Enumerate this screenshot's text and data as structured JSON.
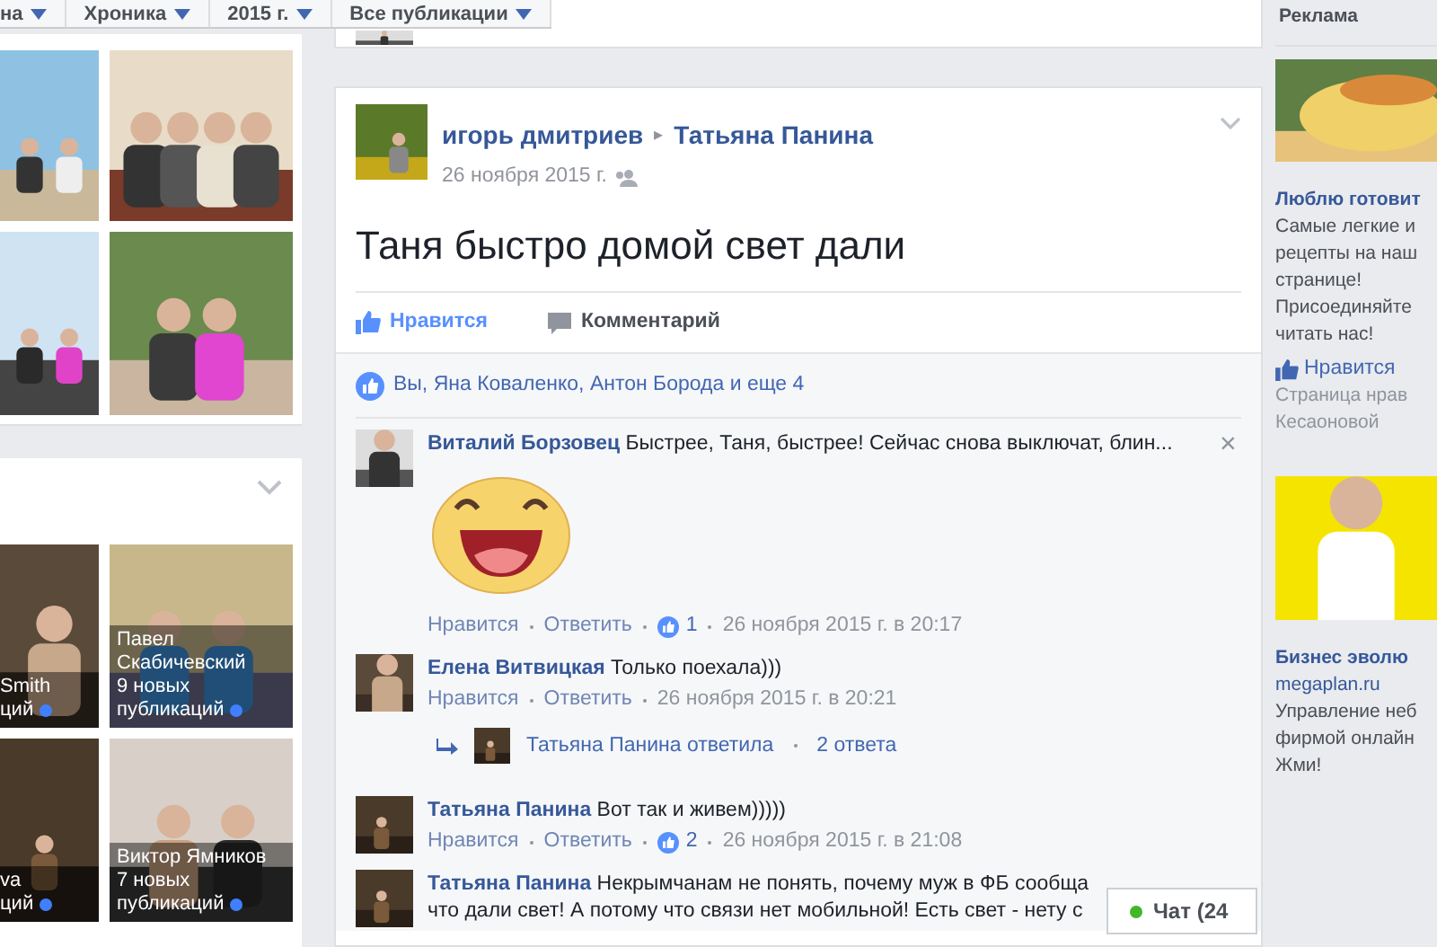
{
  "filter_bar": [
    {
      "label": "на"
    },
    {
      "label": "Хроника"
    },
    {
      "label": "2015 г."
    },
    {
      "label": "Все публикации"
    }
  ],
  "friends": [
    {
      "name": "Smith",
      "posts": "ций"
    },
    {
      "name": "Павел Скабичевский",
      "posts": "9 новых публикаций"
    },
    {
      "name": "va",
      "posts": "ций"
    },
    {
      "name": "Виктор Ямников",
      "posts": "7 новых публикаций"
    }
  ],
  "post": {
    "author": "игорь дмитриев",
    "separator": "▸",
    "target": "Татьяна Панина",
    "date": "26 ноября 2015 г.",
    "text": "Таня быстро домой свет дали",
    "actions": [
      {
        "label": "Нравится",
        "kind": "like"
      },
      {
        "label": "Комментарий",
        "kind": "comment"
      }
    ],
    "likes": "Вы, Яна Коваленко, Антон Борода и еще 4"
  },
  "comments": [
    {
      "kind": "comment",
      "name": "Виталий Борзовец",
      "text": "Быстрее, Таня, быстрее! Сейчас снова выключат, блин...",
      "close": "×",
      "sticker": true,
      "actions": [
        "Нравится",
        "Ответить"
      ],
      "reactions": "1",
      "date": "26 ноября 2015 г. в 20:17"
    },
    {
      "kind": "comment",
      "name": "Елена Витвицкая",
      "text": "Только поехала)))",
      "actions": [
        "Нравится",
        "Ответить"
      ],
      "date": "26 ноября 2015 г. в 20:21"
    },
    {
      "kind": "replies",
      "text": "Татьяна Панина ответила",
      "count": "2 ответа"
    },
    {
      "kind": "comment",
      "name": "Татьяна Панина",
      "text": "Вот так и живем)))))",
      "actions": [
        "Нравится",
        "Ответить"
      ],
      "reactions": "2",
      "date": "26 ноября 2015 г. в 21:08"
    },
    {
      "kind": "comment",
      "name": "Татьяна Панина",
      "text": "Некрымчанам не понять, почему муж в ФБ сообща что дали свет! А потому что связи нет мобильной! Есть свет - нету с"
    }
  ],
  "chat": {
    "label": "Чат (24"
  },
  "ads": {
    "heading": "Реклама",
    "items": [
      {
        "title": "Люблю готовит",
        "lines": [
          "Самые легкие и",
          "рецепты на наш",
          "странице!",
          "Присоединяйте",
          "читать нас!"
        ],
        "like": "Нравится",
        "footer": [
          "Страница нрав",
          "Кесаоновой"
        ]
      },
      {
        "title": "Бизнес эволю",
        "site": "megaplan.ru",
        "lines": [
          "Управление неб",
          "фирмой онлайн",
          "Жми!"
        ]
      }
    ]
  }
}
